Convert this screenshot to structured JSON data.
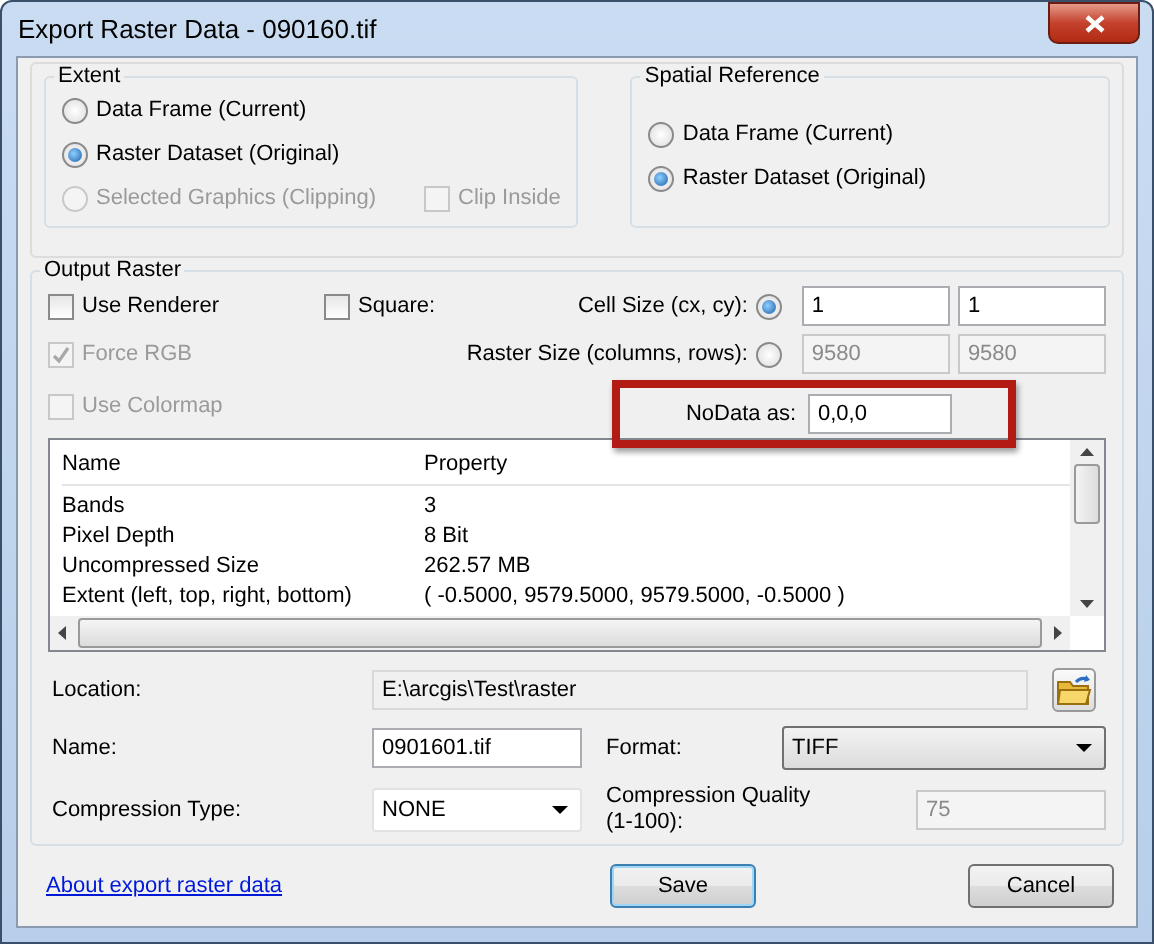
{
  "window": {
    "title": "Export Raster Data - 090160.tif"
  },
  "extent": {
    "title": "Extent",
    "options": [
      {
        "label": "Data Frame (Current)",
        "selected": false,
        "disabled": false
      },
      {
        "label": "Raster Dataset (Original)",
        "selected": true,
        "disabled": false
      },
      {
        "label": "Selected Graphics (Clipping)",
        "selected": false,
        "disabled": true
      }
    ],
    "clip_inside": {
      "label": "Clip Inside",
      "checked": false,
      "disabled": true
    }
  },
  "spatial_reference": {
    "title": "Spatial Reference",
    "options": [
      {
        "label": "Data Frame (Current)",
        "selected": false,
        "disabled": false
      },
      {
        "label": "Raster Dataset (Original)",
        "selected": true,
        "disabled": false
      }
    ]
  },
  "output_raster": {
    "title": "Output Raster",
    "use_renderer": {
      "label": "Use Renderer",
      "checked": false,
      "disabled": false
    },
    "square": {
      "label": "Square:",
      "checked": false,
      "disabled": false
    },
    "force_rgb": {
      "label": "Force RGB",
      "checked": true,
      "disabled": true
    },
    "use_colormap": {
      "label": "Use Colormap",
      "checked": false,
      "disabled": true
    },
    "cell_size": {
      "label": "Cell Size (cx, cy):",
      "selected": true,
      "values": [
        "1",
        "1"
      ]
    },
    "raster_size": {
      "label": "Raster Size (columns, rows):",
      "selected": false,
      "values": [
        "9580",
        "9580"
      ]
    },
    "nodata": {
      "label": "NoData as:",
      "value": "0,0,0",
      "highlighted": true
    }
  },
  "properties_table": {
    "columns": [
      "Name",
      "Property"
    ],
    "rows": [
      [
        "Bands",
        "3"
      ],
      [
        "Pixel Depth",
        "8 Bit"
      ],
      [
        "Uncompressed Size",
        "262.57 MB"
      ],
      [
        "Extent (left, top, right, bottom)",
        "( -0.5000, 9579.5000, 9579.5000, -0.5000 )"
      ]
    ]
  },
  "location": {
    "label": "Location:",
    "value": "E:\\arcgis\\Test\\raster"
  },
  "name": {
    "label": "Name:",
    "value": "0901601.tif"
  },
  "format": {
    "label": "Format:",
    "value": "TIFF"
  },
  "compression_type": {
    "label": "Compression Type:",
    "value": "NONE"
  },
  "compression_quality": {
    "label": "Compression Quality (1-100):",
    "value": "75",
    "disabled": true
  },
  "link": "About export raster data",
  "buttons": [
    {
      "label": "Save",
      "default": true
    },
    {
      "label": "Cancel",
      "default": false
    }
  ]
}
